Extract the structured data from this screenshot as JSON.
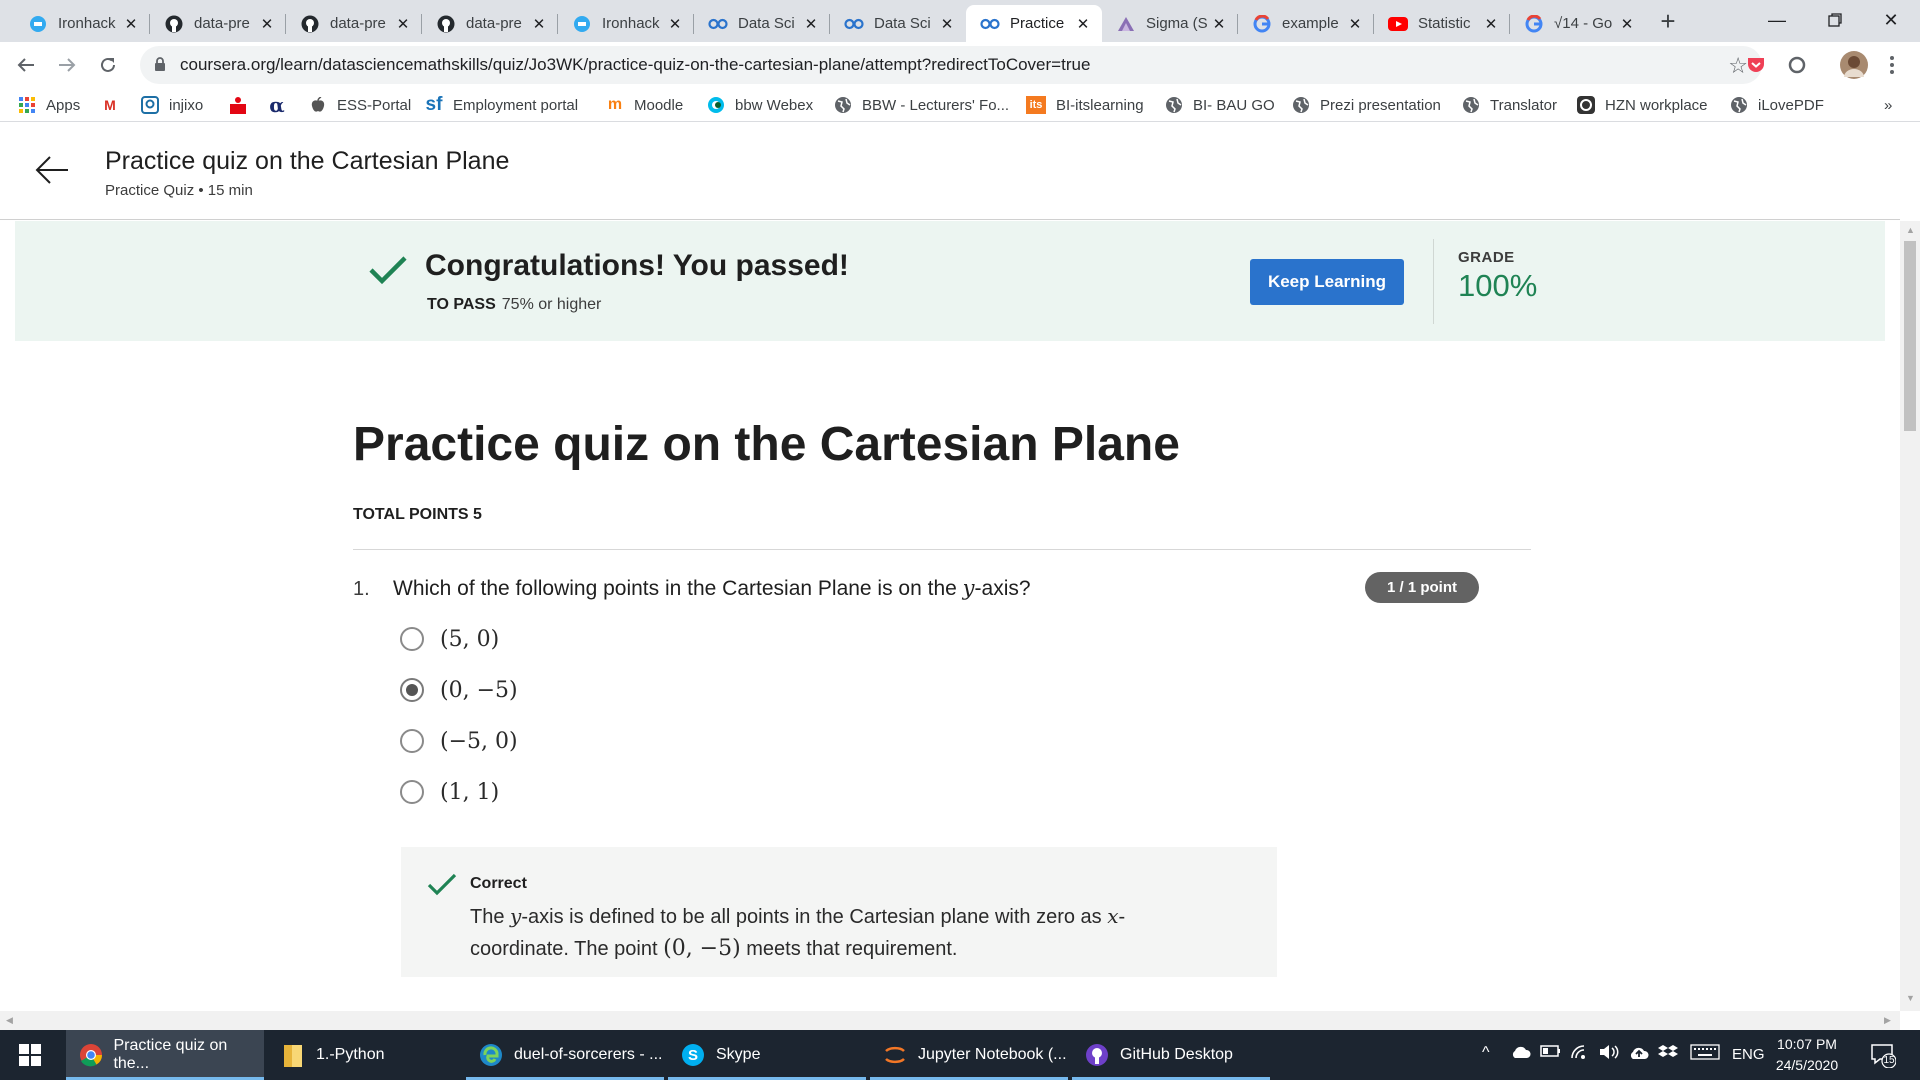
{
  "browser": {
    "tabs": [
      {
        "label": "Ironhack",
        "icon": "ironhack-icon"
      },
      {
        "label": "data-pre",
        "icon": "github-icon"
      },
      {
        "label": "data-pre",
        "icon": "github-icon"
      },
      {
        "label": "data-pre",
        "icon": "github-icon"
      },
      {
        "label": "Ironhack",
        "icon": "ironhack-icon"
      },
      {
        "label": "Data Sci",
        "icon": "coursera-icon"
      },
      {
        "label": "Data Sci",
        "icon": "coursera-icon"
      },
      {
        "label": "Practice",
        "icon": "coursera-icon",
        "active": true
      },
      {
        "label": "Sigma (S",
        "icon": "sigma-icon"
      },
      {
        "label": "example",
        "icon": "google-icon"
      },
      {
        "label": "Statistic",
        "icon": "youtube-icon"
      },
      {
        "label": "√14 - Go",
        "icon": "google-icon"
      }
    ],
    "url": "coursera.org/learn/datasciencemathskills/quiz/Jo3WK/practice-quiz-on-the-cartesian-plane/attempt?redirectToCover=true",
    "bookmarks": [
      {
        "label": "Apps",
        "icon": "apps-grid-icon"
      },
      {
        "label": "",
        "icon": "gmail-icon"
      },
      {
        "label": "injixo",
        "icon": "injixo-icon"
      },
      {
        "label": "",
        "icon": "sparkasse-icon"
      },
      {
        "label": "",
        "icon": "alpha-icon"
      },
      {
        "label": "ESS-Portal",
        "icon": "apple-icon"
      },
      {
        "label": "Employment portal",
        "icon": "sf-icon"
      },
      {
        "label": "Moodle",
        "icon": "moodle-icon"
      },
      {
        "label": "bbw Webex",
        "icon": "webex-icon"
      },
      {
        "label": "BBW - Lecturers' Fo...",
        "icon": "globe-icon"
      },
      {
        "label": "BI-itslearning",
        "icon": "its-icon"
      },
      {
        "label": "BI- BAU GO",
        "icon": "globe-icon"
      },
      {
        "label": "Prezi presentation",
        "icon": "globe-icon"
      },
      {
        "label": "Translator",
        "icon": "globe-icon"
      },
      {
        "label": "HZN workplace",
        "icon": "hzn-icon"
      },
      {
        "label": "iLovePDF",
        "icon": "globe-icon"
      }
    ],
    "bookmarks_more": "»"
  },
  "header": {
    "title": "Practice quiz on the Cartesian Plane",
    "subtitle": "Practice Quiz • 15 min"
  },
  "banner": {
    "title": "Congratulations! You passed!",
    "to_pass_label": "TO PASS",
    "to_pass_value": "75% or higher",
    "button": "Keep Learning",
    "grade_label": "GRADE",
    "grade_value": "100%",
    "accent_color": "#1f8354",
    "button_color": "#2a73cc"
  },
  "quiz": {
    "title": "Practice quiz on the Cartesian Plane",
    "total_points": "TOTAL POINTS 5",
    "question": {
      "number": "1.",
      "text_before": "Which of the following points in the Cartesian Plane is on the ",
      "var": "y",
      "text_after": "-axis?",
      "points": "1 / 1 point",
      "options": [
        {
          "label": "(5, 0)",
          "selected": false
        },
        {
          "label": "(0, −5)",
          "selected": true
        },
        {
          "label": "(−5, 0)",
          "selected": false
        },
        {
          "label": "(1, 1)",
          "selected": false
        }
      ],
      "feedback": {
        "title": "Correct",
        "t1": "The ",
        "v1": "y",
        "t2": "-axis is defined to be all points in the Cartesian plane with zero as ",
        "v2": "x",
        "t3": "-coordinate. The point ",
        "v3": "(0, −5)",
        "t4": " meets that requirement."
      }
    }
  },
  "taskbar": {
    "apps": [
      {
        "label": "Practice quiz on the...",
        "icon": "chrome-icon",
        "active": true
      },
      {
        "label": "1.-Python",
        "icon": "folder-icon"
      },
      {
        "label": "duel-of-sorcerers - ...",
        "icon": "edge-icon"
      },
      {
        "label": "Skype",
        "icon": "skype-icon"
      },
      {
        "label": "Jupyter Notebook (...",
        "icon": "jupyter-icon"
      },
      {
        "label": "GitHub Desktop",
        "icon": "github-desktop-icon"
      }
    ],
    "language": "ENG",
    "time": "10:07 PM",
    "date": "24/5/2020",
    "notifications": "15"
  }
}
